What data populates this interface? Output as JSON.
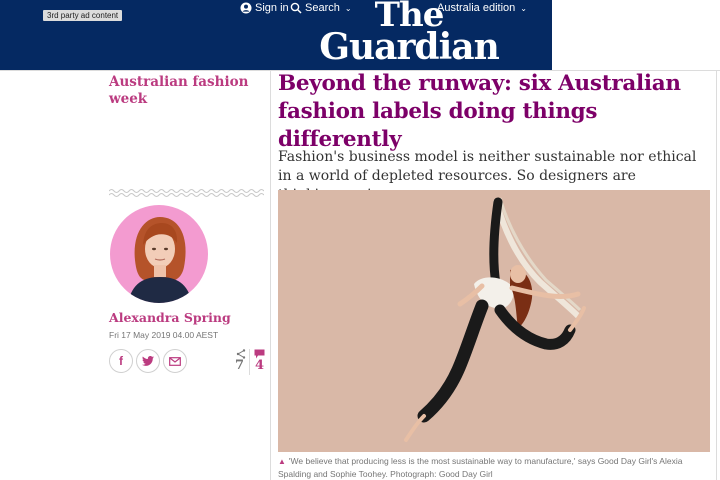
{
  "header": {
    "ad_label": "3rd party ad content",
    "sign_in": "Sign in",
    "search": "Search",
    "edition": "Australia edition",
    "logo_line1": "The",
    "logo_line2": "Guardian",
    "brand_color": "#052962"
  },
  "section": {
    "label": "Australian fashion week",
    "accent_color": "#bb3b80"
  },
  "article": {
    "headline": "Beyond the runway: six Australian fashion labels doing things differently",
    "standfirst": "Fashion's business model is neither sustainable nor ethical in a world of depleted resources. So designers are thinking again",
    "headline_color": "#7d0068"
  },
  "byline": {
    "author": "Alexandra Spring",
    "date": "Fri 17 May 2019 04.00 AEST"
  },
  "share": {
    "facebook_icon": "f",
    "twitter_icon": "twitter-icon",
    "email_icon": "email-icon",
    "share_count": "7",
    "comment_count": "4"
  },
  "image": {
    "caption": "'We believe that producing less is the most sustainable way to manufacture,' says Good Day Girl's Alexia Spalding and Sophie Toohey. Photograph: Good Day Girl"
  }
}
